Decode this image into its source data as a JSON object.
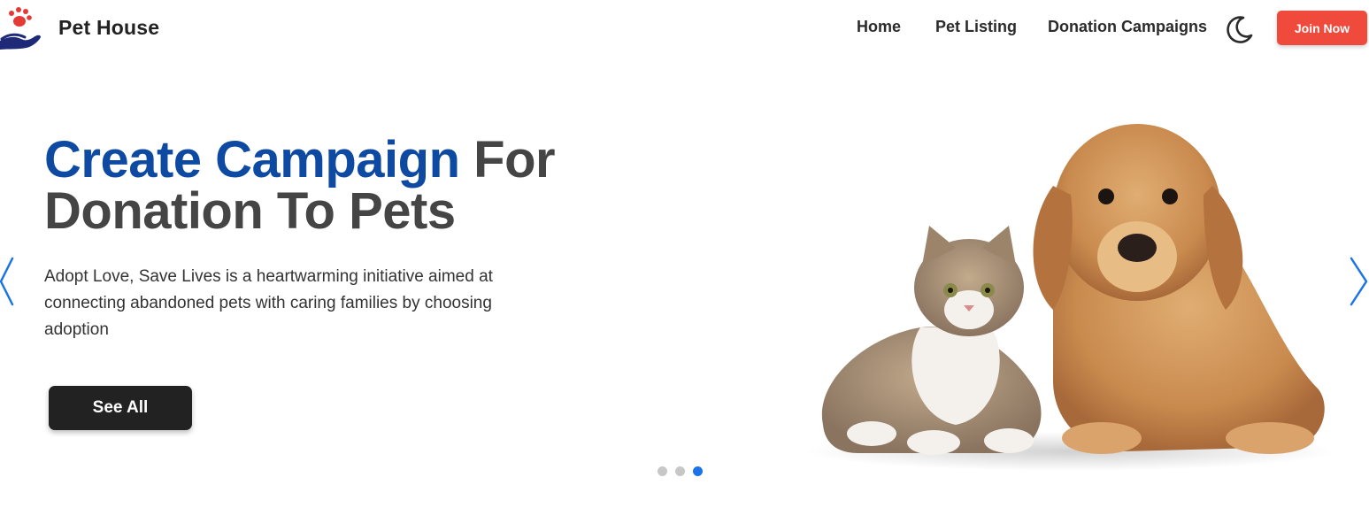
{
  "navbar": {
    "brand": "Pet House",
    "links": [
      "Home",
      "Pet Listing",
      "Donation Campaigns"
    ],
    "theme_icon": "moon-icon",
    "join_label": "Join Now"
  },
  "hero": {
    "title_accent": "Create Campaign",
    "title_rest": " For Donation To Pets",
    "description": "Adopt Love, Save Lives is a heartwarming initiative aimed at connecting abandoned pets with caring families by choosing adoption",
    "cta_label": "See All"
  },
  "carousel": {
    "slide_count": 3,
    "active_index": 2,
    "prev_icon": "chevron-left-icon",
    "next_icon": "chevron-right-icon"
  },
  "colors": {
    "accent_blue": "#0e4aa1",
    "join_red": "#ef4a3c",
    "dot_active": "#1a73e8",
    "dot_inactive": "#c7c7c7",
    "paw_red": "#e53935",
    "hand_navy": "#1e2a78"
  }
}
